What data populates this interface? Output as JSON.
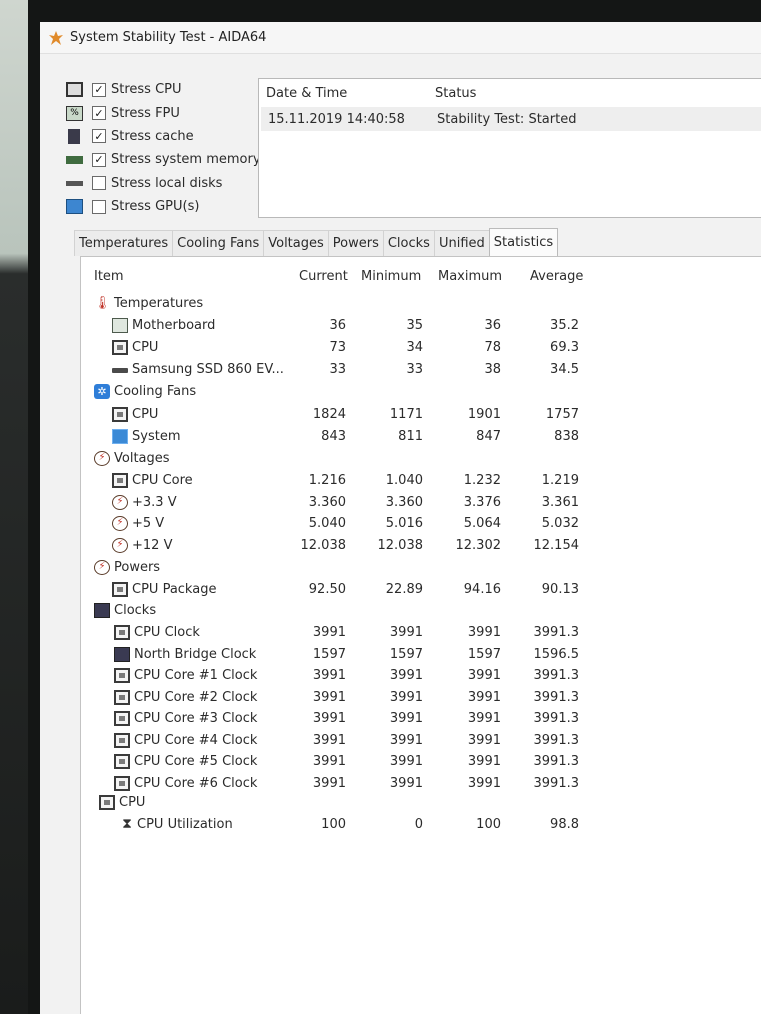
{
  "window": {
    "title": "System Stability Test - AIDA64"
  },
  "stress_options": [
    {
      "label": "Stress CPU",
      "checked": true,
      "icon": "cpu-chip-icon"
    },
    {
      "label": "Stress FPU",
      "checked": true,
      "icon": "fpu-icon"
    },
    {
      "label": "Stress cache",
      "checked": true,
      "icon": "cache-icon"
    },
    {
      "label": "Stress system memory",
      "checked": true,
      "icon": "memory-icon"
    },
    {
      "label": "Stress local disks",
      "checked": false,
      "icon": "disk-icon"
    },
    {
      "label": "Stress GPU(s)",
      "checked": false,
      "icon": "gpu-monitor-icon"
    }
  ],
  "status_table": {
    "headers": {
      "datetime": "Date & Time",
      "status": "Status"
    },
    "row": {
      "datetime": "15.11.2019 14:40:58",
      "status": "Stability Test: Started"
    }
  },
  "tabs": [
    "Temperatures",
    "Cooling Fans",
    "Voltages",
    "Powers",
    "Clocks",
    "Unified",
    "Statistics"
  ],
  "active_tab": "Statistics",
  "stats": {
    "headers": {
      "item": "Item",
      "current": "Current",
      "minimum": "Minimum",
      "maximum": "Maximum",
      "average": "Average"
    },
    "rows": [
      {
        "label": "Temperatures",
        "group": true,
        "icon": "thermometer-icon"
      },
      {
        "label": "Motherboard",
        "icon": "motherboard-icon",
        "current": "36",
        "minimum": "35",
        "maximum": "36",
        "average": "35.2"
      },
      {
        "label": "CPU",
        "icon": "cpu-chip-icon",
        "current": "73",
        "minimum": "34",
        "maximum": "78",
        "average": "69.3"
      },
      {
        "label": "Samsung SSD 860 EV...",
        "icon": "ssd-icon",
        "current": "33",
        "minimum": "33",
        "maximum": "38",
        "average": "34.5"
      },
      {
        "label": "Cooling Fans",
        "group": true,
        "icon": "fan-icon"
      },
      {
        "label": "CPU",
        "icon": "cpu-chip-icon",
        "current": "1824",
        "minimum": "1171",
        "maximum": "1901",
        "average": "1757"
      },
      {
        "label": "System",
        "icon": "monitor-icon",
        "current": "843",
        "minimum": "811",
        "maximum": "847",
        "average": "838"
      },
      {
        "label": "Voltages",
        "group": true,
        "icon": "voltage-icon"
      },
      {
        "label": "CPU Core",
        "icon": "cpu-chip-icon",
        "current": "1.216",
        "minimum": "1.040",
        "maximum": "1.232",
        "average": "1.219"
      },
      {
        "label": "+3.3 V",
        "icon": "voltage-icon",
        "current": "3.360",
        "minimum": "3.360",
        "maximum": "3.376",
        "average": "3.361"
      },
      {
        "label": "+5 V",
        "icon": "voltage-icon",
        "current": "5.040",
        "minimum": "5.016",
        "maximum": "5.064",
        "average": "5.032"
      },
      {
        "label": "+12 V",
        "icon": "voltage-icon",
        "current": "12.038",
        "minimum": "12.038",
        "maximum": "12.302",
        "average": "12.154"
      },
      {
        "label": "Powers",
        "group": true,
        "icon": "voltage-icon"
      },
      {
        "label": "CPU Package",
        "icon": "cpu-chip-icon",
        "current": "92.50",
        "minimum": "22.89",
        "maximum": "94.16",
        "average": "90.13"
      },
      {
        "label": "Clocks",
        "group": true,
        "icon": "clock-bar-icon"
      },
      {
        "label": "CPU Clock",
        "icon": "cpu-chip-icon",
        "current": "3991",
        "minimum": "3991",
        "maximum": "3991",
        "average": "3991.3"
      },
      {
        "label": "North Bridge Clock",
        "icon": "north-bridge-icon",
        "current": "1597",
        "minimum": "1597",
        "maximum": "1597",
        "average": "1596.5"
      },
      {
        "label": "CPU Core #1 Clock",
        "icon": "cpu-chip-icon",
        "current": "3991",
        "minimum": "3991",
        "maximum": "3991",
        "average": "3991.3"
      },
      {
        "label": "CPU Core #2 Clock",
        "icon": "cpu-chip-icon",
        "current": "3991",
        "minimum": "3991",
        "maximum": "3991",
        "average": "3991.3"
      },
      {
        "label": "CPU Core #3 Clock",
        "icon": "cpu-chip-icon",
        "current": "3991",
        "minimum": "3991",
        "maximum": "3991",
        "average": "3991.3"
      },
      {
        "label": "CPU Core #4 Clock",
        "icon": "cpu-chip-icon",
        "current": "3991",
        "minimum": "3991",
        "maximum": "3991",
        "average": "3991.3"
      },
      {
        "label": "CPU Core #5 Clock",
        "icon": "cpu-chip-icon",
        "current": "3991",
        "minimum": "3991",
        "maximum": "3991",
        "average": "3991.3"
      },
      {
        "label": "CPU Core #6 Clock",
        "icon": "cpu-chip-icon",
        "current": "3991",
        "minimum": "3991",
        "maximum": "3991",
        "average": "3991.3"
      },
      {
        "label": "CPU",
        "group": true,
        "icon": "cpu-chip-icon"
      },
      {
        "label": "CPU Utilization",
        "icon": "hourglass-icon",
        "current": "100",
        "minimum": "0",
        "maximum": "100",
        "average": "98.8"
      }
    ]
  }
}
